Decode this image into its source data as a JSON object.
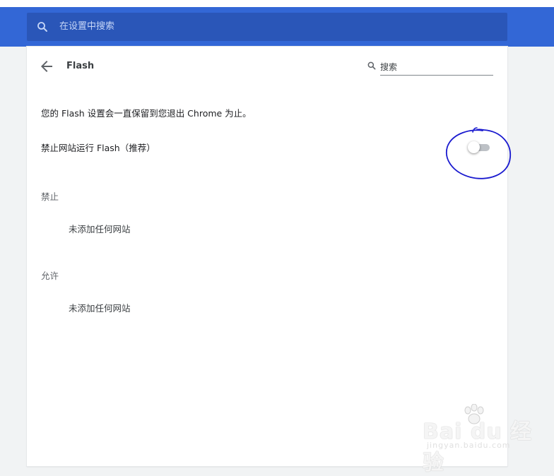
{
  "header": {
    "search_placeholder": "在设置中搜索"
  },
  "subpage": {
    "title": "Flash",
    "search_placeholder": "搜索"
  },
  "content": {
    "info_text": "您的 Flash 设置会一直保留到您退出 Chrome 为止。",
    "toggle_label": "禁止网站运行 Flash（推荐）",
    "toggle_on": false,
    "sections": [
      {
        "heading": "禁止",
        "empty_text": "未添加任何网站"
      },
      {
        "heading": "允许",
        "empty_text": "未添加任何网站"
      }
    ]
  },
  "icons": {
    "header_search": "search-icon",
    "back": "arrow-back-icon",
    "subpage_search": "search-icon"
  },
  "colors": {
    "header_bar": "#3367d6",
    "header_search_box": "#2a56b8",
    "annotation": "#1a1acf"
  },
  "watermark": {
    "brand": "Bai du 经验",
    "url": "jingyan.baidu.com"
  }
}
